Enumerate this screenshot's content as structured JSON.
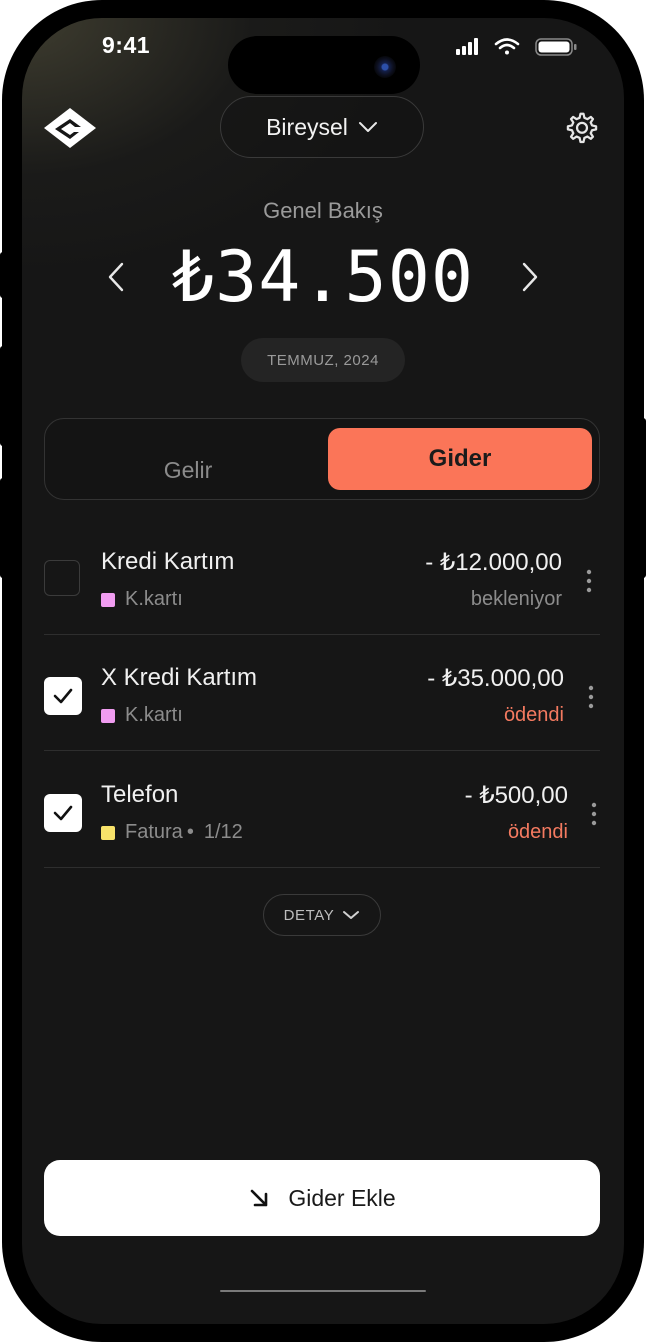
{
  "status_bar": {
    "time": "9:41"
  },
  "header": {
    "profile_label": "Bireysel"
  },
  "summary": {
    "title": "Genel Bakış",
    "balance": "₺34.500",
    "period": "TEMMUZ, 2024"
  },
  "tabs": [
    {
      "label": "Gelir",
      "selected": false
    },
    {
      "label": "Gider",
      "selected": true
    }
  ],
  "transactions": [
    {
      "name": "Kredi Kartım",
      "category": "K.kartı",
      "category_color": "#f09cf0",
      "installment": "",
      "amount": "- ₺12.000,00",
      "status": "bekleniyor",
      "checked": false
    },
    {
      "name": "X Kredi Kartım",
      "category": "K.kartı",
      "category_color": "#f09cf0",
      "installment": "",
      "amount": "- ₺35.000,00",
      "status": "ödendi",
      "checked": true
    },
    {
      "name": "Telefon",
      "category": "Fatura",
      "category_color": "#f8e36a",
      "installment": "1/12",
      "amount": "- ₺500,00",
      "status": "ödendi",
      "checked": true
    }
  ],
  "detail_button": {
    "label": "DETAY"
  },
  "add_button": {
    "label": "Gider Ekle"
  },
  "colors": {
    "accent": "#fb7558",
    "paid_status": "#f47a60",
    "pending_status": "#8c8c8c",
    "background": "#161616"
  },
  "icons": [
    "app-logo-icon",
    "chevron-down-icon",
    "gear-icon",
    "chevron-left-icon",
    "chevron-right-icon",
    "check-icon",
    "kebab-menu-icon",
    "arrow-down-right-icon"
  ]
}
